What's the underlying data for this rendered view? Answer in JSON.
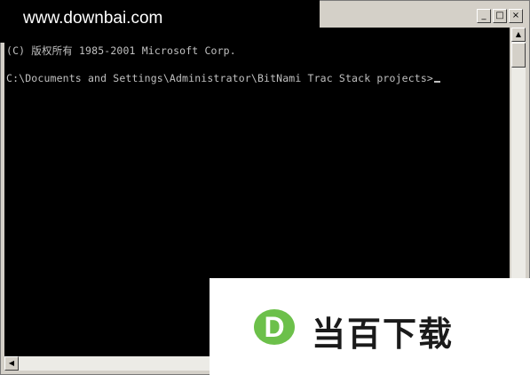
{
  "watermark": {
    "site_url": "www.downbai.com",
    "logo_letter": "D",
    "logo_text": "当百下载",
    "logo_color": "#6cc04a"
  },
  "window": {
    "minimize_glyph": "_",
    "maximize_glyph": "□",
    "close_glyph": "×"
  },
  "console": {
    "lines": [
      "(C) 版权所有 1985-2001 Microsoft Corp.",
      "C:\\Documents and Settings\\Administrator\\BitNami Trac Stack projects>"
    ],
    "text_color": "#c0c0c0",
    "background": "#000000"
  },
  "scrollbars": {
    "up_glyph": "▲",
    "left_glyph": "◀"
  }
}
